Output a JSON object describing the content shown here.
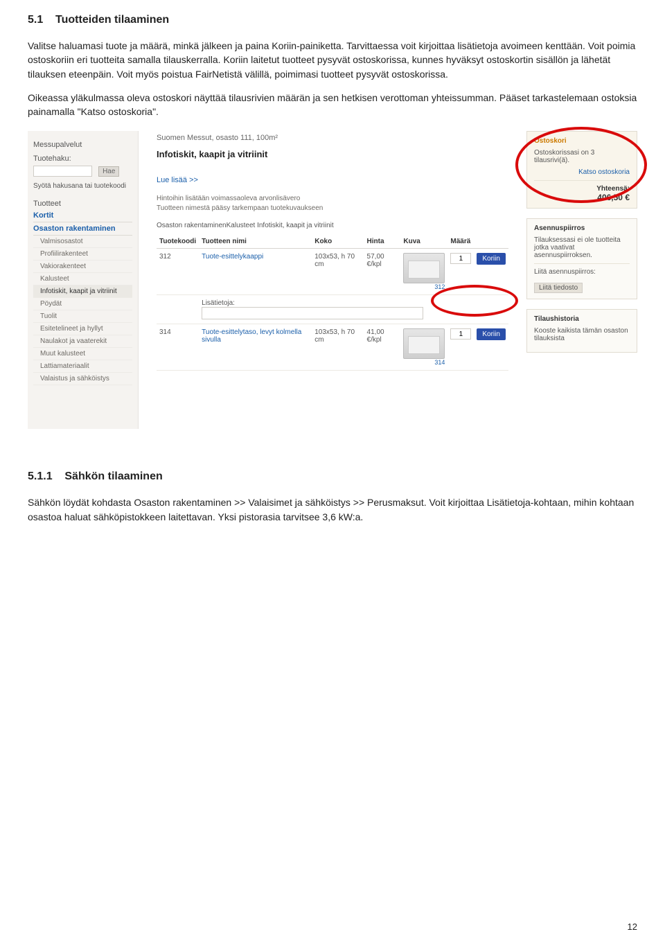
{
  "section1": {
    "number": "5.1",
    "title": "Tuotteiden tilaaminen",
    "p1": "Valitse haluamasi tuote ja määrä, minkä jälkeen ja paina Koriin-painiketta. Tarvittaessa voit kirjoittaa lisätietoja avoimeen kenttään. Voit poimia ostoskoriin eri tuotteita samalla tilauskerralla. Koriin laitetut tuotteet pysyvät ostoskorissa, kunnes hyväksyt ostoskortin sisällön ja lähetät tilauksen eteenpäin. Voit myös poistua FairNetistä välillä, poimimasi tuotteet pysyvät ostoskorissa.",
    "p2": "Oikeassa yläkulmassa oleva ostoskori näyttää tilausrivien määrän ja sen hetkisen verottoman yhteissumman. Pääset tarkastelemaan ostoksia painamalla \"Katso ostoskoria\"."
  },
  "sidebar": {
    "messupalvelut": "Messupalvelut",
    "tuotehaku": "Tuotehaku:",
    "hae": "Hae",
    "syota": "Syötä hakusana tai tuotekoodi",
    "tuotteet": "Tuotteet",
    "items": [
      "Kortit",
      "Osaston rakentaminen",
      "Valmisosastot",
      "Profiilirakenteet",
      "Vakiorakenteet",
      "Kalusteet",
      "Infotiskit, kaapit ja vitriinit",
      "Pöydät",
      "Tuolit",
      "Esitetelineet ja hyllyt",
      "Naulakot ja vaaterekit",
      "Muut kalusteet",
      "Lattiamateriaalit",
      "Valaistus ja sähköistys"
    ]
  },
  "center": {
    "crumb": "Suomen Messut, osasto 111, 100m²",
    "title": "Infotiskit, kaapit ja vitriinit",
    "luelisaa": "Lue lisää >>",
    "note1": "Hintoihin lisätään voimassaoleva arvonlisävero",
    "note2": "Tuotteen nimestä pääsy tarkempaan tuotekuvaukseen",
    "bcrumb": "Osaston rakentaminenKalusteet Infotiskit, kaapit ja vitriinit",
    "cols": {
      "koodi": "Tuotekoodi",
      "nimi": "Tuotteen nimi",
      "koko": "Koko",
      "hinta": "Hinta",
      "kuva": "Kuva",
      "maara": "Määrä"
    },
    "rows": [
      {
        "koodi": "312",
        "nimi": "Tuote-esittelykaappi",
        "koko": "103x53, h 70 cm",
        "hinta": "57,00 €/kpl",
        "imgnum": "312",
        "qty": "1"
      },
      {
        "koodi": "314",
        "nimi": "Tuote-esittelytaso, levyt kolmella sivulla",
        "koko": "103x53, h 70 cm",
        "hinta": "41,00 €/kpl",
        "imgnum": "314",
        "qty": "1"
      }
    ],
    "lisatietoja": "Lisätietoja:",
    "koriin": "Koriin"
  },
  "right": {
    "ostoskori": {
      "hdr": "Ostoskori",
      "lines": "Ostoskorissasi on 3 tilausrivi(ä).",
      "katso": "Katso ostoskoria",
      "yht_lbl": "Yhteensä:",
      "yht_val": "406,50 €"
    },
    "asennus": {
      "hdr": "Asennuspiirros",
      "txt": "Tilauksessasi ei ole tuotteita jotka vaativat asennuspiirroksen.",
      "liita": "Liitä asennuspiirros:",
      "btn": "Liitä tiedosto"
    },
    "hist": {
      "hdr": "Tilaushistoria",
      "txt": "Kooste kaikista tämän osaston tilauksista"
    }
  },
  "section2": {
    "number": "5.1.1",
    "title": "Sähkön tilaaminen",
    "p1": "Sähkön löydät kohdasta Osaston rakentaminen >> Valaisimet ja sähköistys >> Perusmaksut. Voit kirjoittaa Lisätietoja-kohtaan, mihin kohtaan osastoa haluat sähköpistokkeen laitettavan. Yksi pistorasia tarvitsee 3,6 kW:a."
  },
  "page_number": "12"
}
